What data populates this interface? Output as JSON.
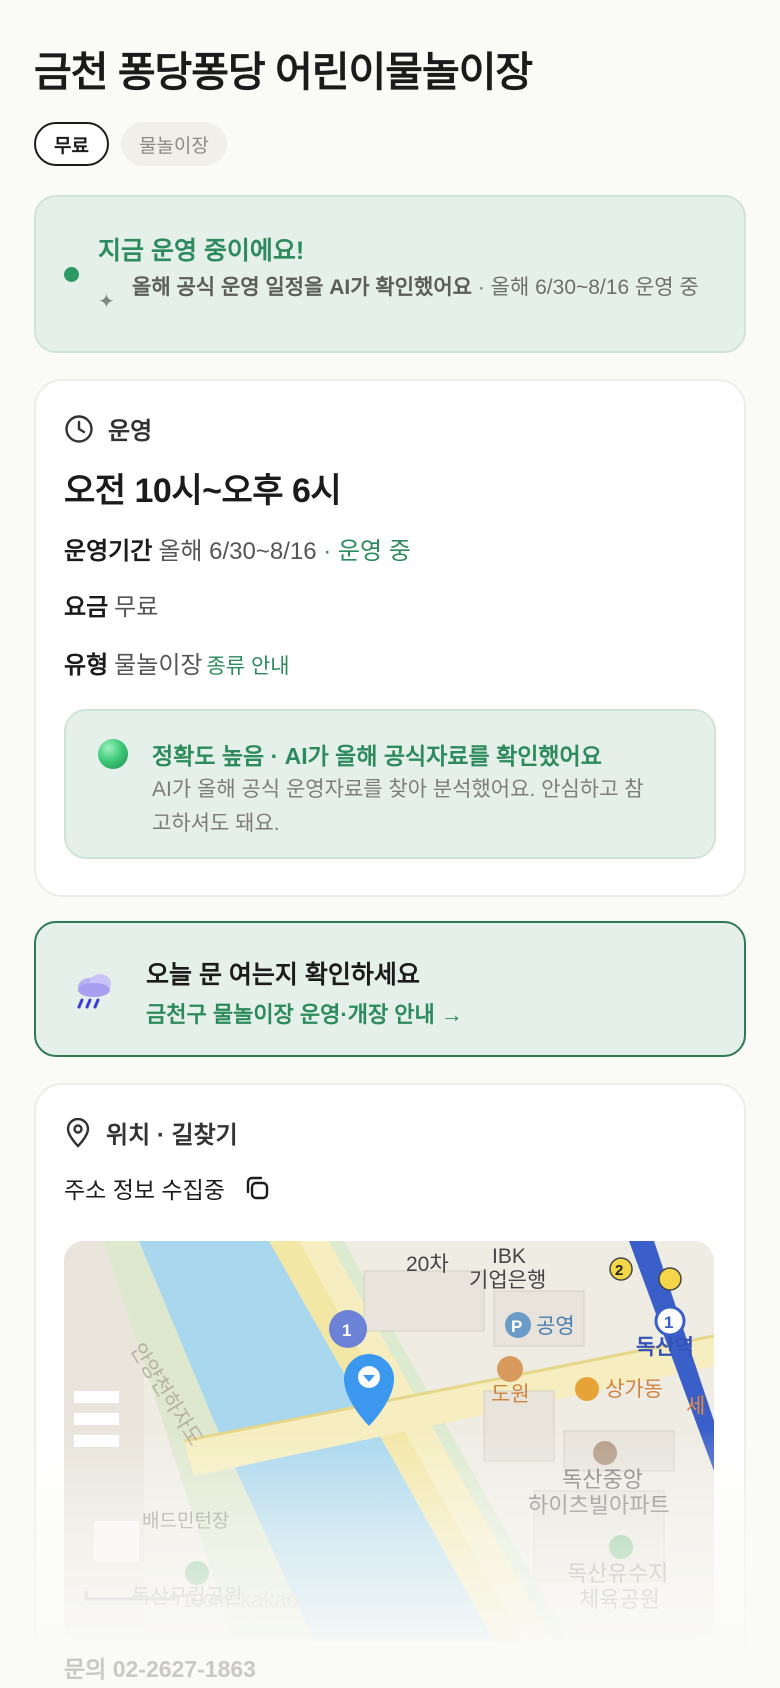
{
  "page": {
    "title": "금천 퐁당퐁당 어린이물놀이장"
  },
  "chips": [
    {
      "label": "무료",
      "selected": true
    },
    {
      "label": "물놀이장",
      "selected": false
    }
  ],
  "status": {
    "title": "지금 운영 중이에요!",
    "sub_bold": "올해 공식 운영 일정을 AI가 확인했어요",
    "sub_rest": " · 올해 6/30~8/16 운영 중"
  },
  "operation": {
    "section_label": "운영",
    "hours": "오전 10시~오후 6시",
    "period_key": "운영기간",
    "period_value": "올해 6/30~8/16",
    "period_status": "· 운영 중",
    "fee_key": "요금",
    "fee_value": "무료",
    "type_key": "유형",
    "type_value": "물놀이장",
    "type_link": "종류 안내",
    "accuracy_title": "정확도 높음 · AI가 올해 공식자료를 확인했어요",
    "accuracy_desc": "AI가 올해 공식 운영자료를 찾아 분석했어요. 안심하고 참고하셔도 돼요."
  },
  "notice": {
    "title": "오늘 문 여는지 확인하세요",
    "link": "금천구 물놀이장 운영·개장 안내 →"
  },
  "location": {
    "section_label": "위치 · 길찾기",
    "address": "주소 정보 수집중",
    "map_labels": {
      "place_top": "20차",
      "bank": "IBK\n기업은행",
      "park": "공영",
      "restaurant": "도원",
      "shop": "상가동",
      "station": "독산역",
      "apartment": "독산중앙\n하이츠빌아파트",
      "park2": "독산유수지\n체육공원",
      "badminton": "배드민턴장",
      "park3": "독산구립공원",
      "road": "안양천하자도",
      "scale": "100m",
      "brand": "kakao",
      "bus1": "1",
      "line1": "1",
      "line2": "2",
      "edge": "세"
    }
  },
  "footer": {
    "phone": "문의 02-2627-1863"
  },
  "colors": {
    "accent": "#2c8a5c",
    "status_bg": "#e6f0ea"
  }
}
